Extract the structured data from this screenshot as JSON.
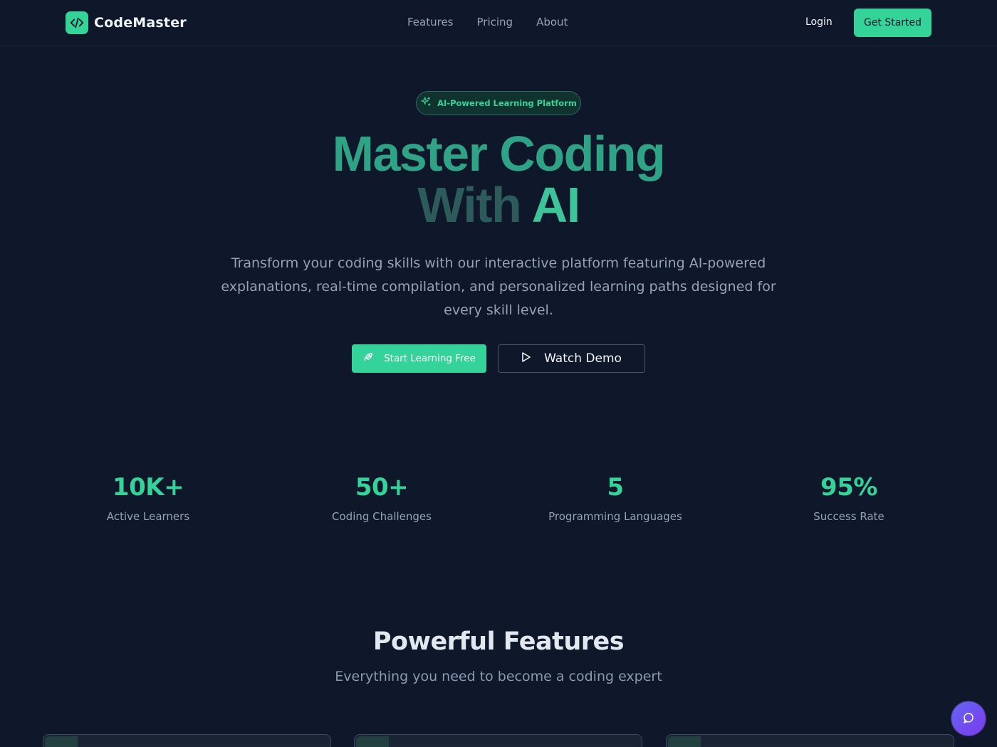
{
  "brand": {
    "name": "CodeMaster",
    "logo_icon": "code-icon",
    "accent": "#34d399"
  },
  "nav": {
    "items": [
      {
        "label": "Features"
      },
      {
        "label": "Pricing"
      },
      {
        "label": "About"
      }
    ]
  },
  "header": {
    "login_label": "Login",
    "cta_label": "Get Started"
  },
  "hero": {
    "badge": {
      "icon": "sparkles-icon",
      "text": "AI-Powered Learning Platform"
    },
    "title_line1": "Master Coding",
    "title_with": "With",
    "title_ai": "AI",
    "subtitle": "Transform your coding skills with our interactive platform featuring AI-powered explanations, real-time compilation, and personalized learning paths designed for every skill level.",
    "primary_cta": {
      "label": "Start Learning Free",
      "icon": "rocket-icon"
    },
    "secondary_cta": {
      "label": "Watch Demo",
      "icon": "play-icon"
    }
  },
  "stats": [
    {
      "value": "10K+",
      "label": "Active Learners"
    },
    {
      "value": "50+",
      "label": "Coding Challenges"
    },
    {
      "value": "5",
      "label": "Programming Languages"
    },
    {
      "value": "95%",
      "label": "Success Rate"
    }
  ],
  "features": {
    "title": "Powerful Features",
    "subtitle": "Everything you need to become a coding expert"
  },
  "chat": {
    "icon": "chat-bubble-icon",
    "color": "#6366f1"
  }
}
